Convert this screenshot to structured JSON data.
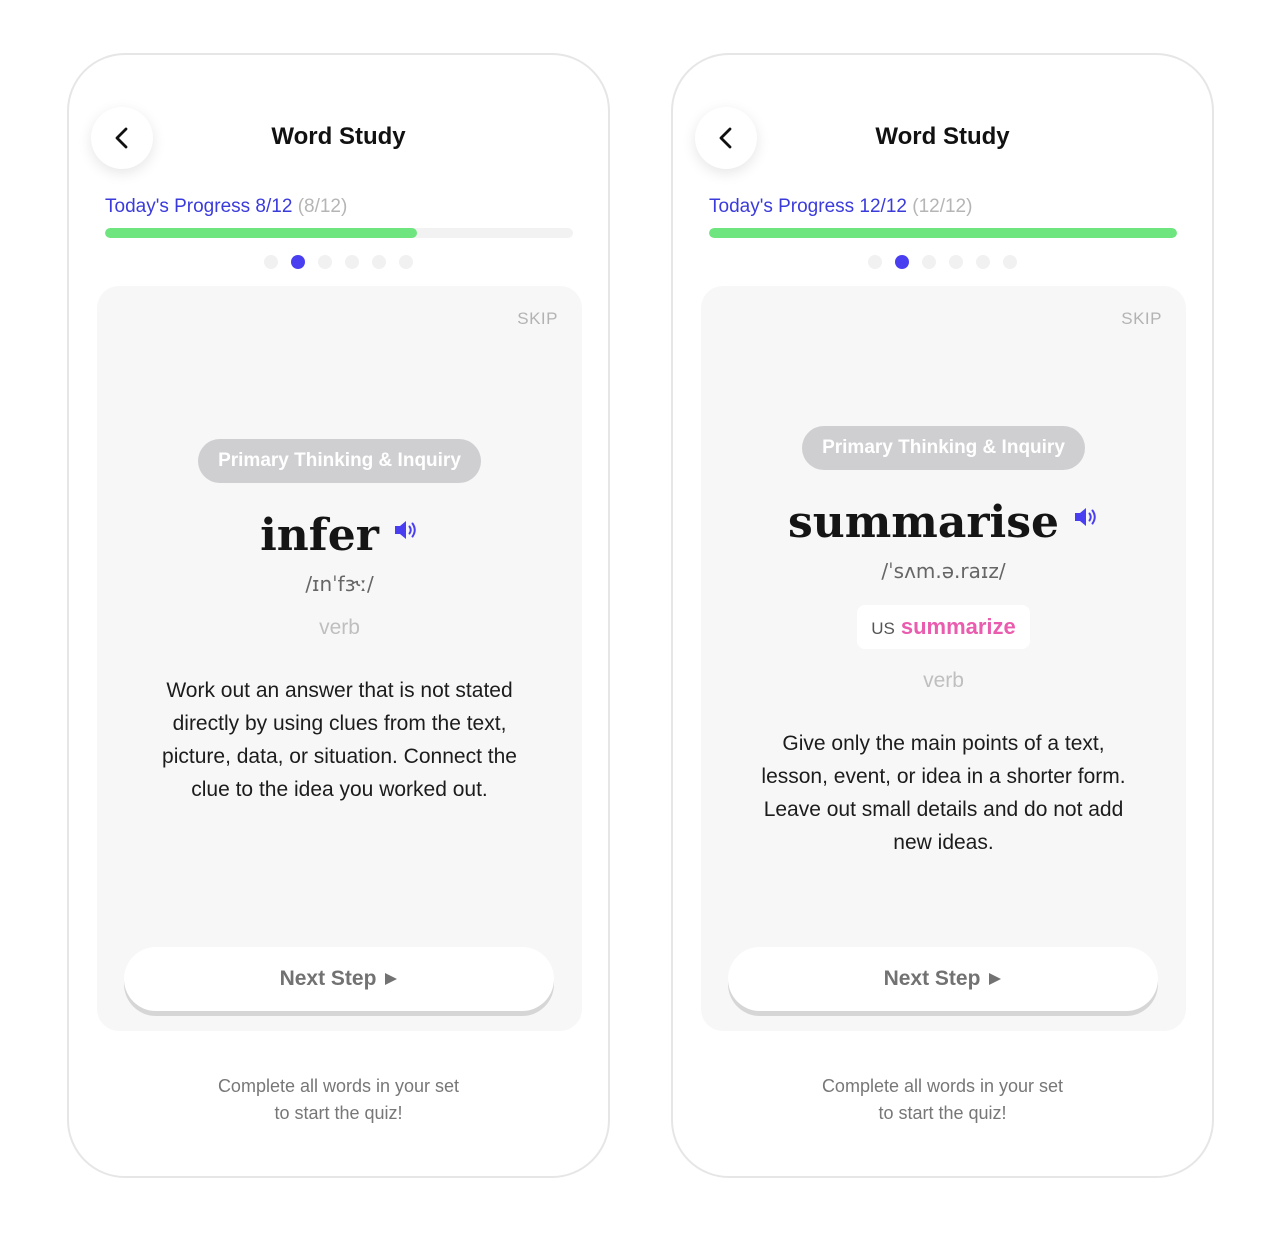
{
  "colors": {
    "accent_blue": "#3b3bdc",
    "progress_green": "#6ee57f",
    "dot_active": "#4a3ff0",
    "us_variant_pink": "#e95cae",
    "category_pill": "#cfcfd2"
  },
  "icons": {
    "back": "chevron-left-icon",
    "audio": "speaker-icon",
    "next": "play-triangle-icon"
  },
  "screens": [
    {
      "header": {
        "title": "Word Study"
      },
      "progress": {
        "label": "Today's Progress 8/12",
        "paren": "(8/12)",
        "done": 8,
        "total": 12,
        "fraction": 0.6667
      },
      "pager": {
        "count": 6,
        "active_index": 1
      },
      "card": {
        "skip_label": "SKIP",
        "category": "Primary Thinking & Inquiry",
        "word": "infer",
        "phonetic": "/ɪnˈfɝː/",
        "part_of_speech": "verb",
        "definition": "Work out an answer that is not stated directly by using clues from the text, picture, data, or situation. Connect the clue to the idea you worked out.",
        "next_label": "Next Step"
      },
      "footer": {
        "line1": "Complete all words in your set",
        "line2": "to start the quiz!"
      }
    },
    {
      "header": {
        "title": "Word Study"
      },
      "progress": {
        "label": "Today's Progress 12/12",
        "paren": "(12/12)",
        "done": 12,
        "total": 12,
        "fraction": 1.0
      },
      "pager": {
        "count": 6,
        "active_index": 1
      },
      "card": {
        "skip_label": "SKIP",
        "category": "Primary Thinking & Inquiry",
        "word": "summarise",
        "phonetic": "/ˈsʌm.ə.raɪz/",
        "us_label": "US",
        "us_variant": "summarize",
        "part_of_speech": "verb",
        "definition": "Give only the main points of a text, lesson, event, or idea in a shorter form. Leave out small details and do not add new ideas.",
        "next_label": "Next Step"
      },
      "footer": {
        "line1": "Complete all words in your set",
        "line2": "to start the quiz!"
      }
    }
  ]
}
